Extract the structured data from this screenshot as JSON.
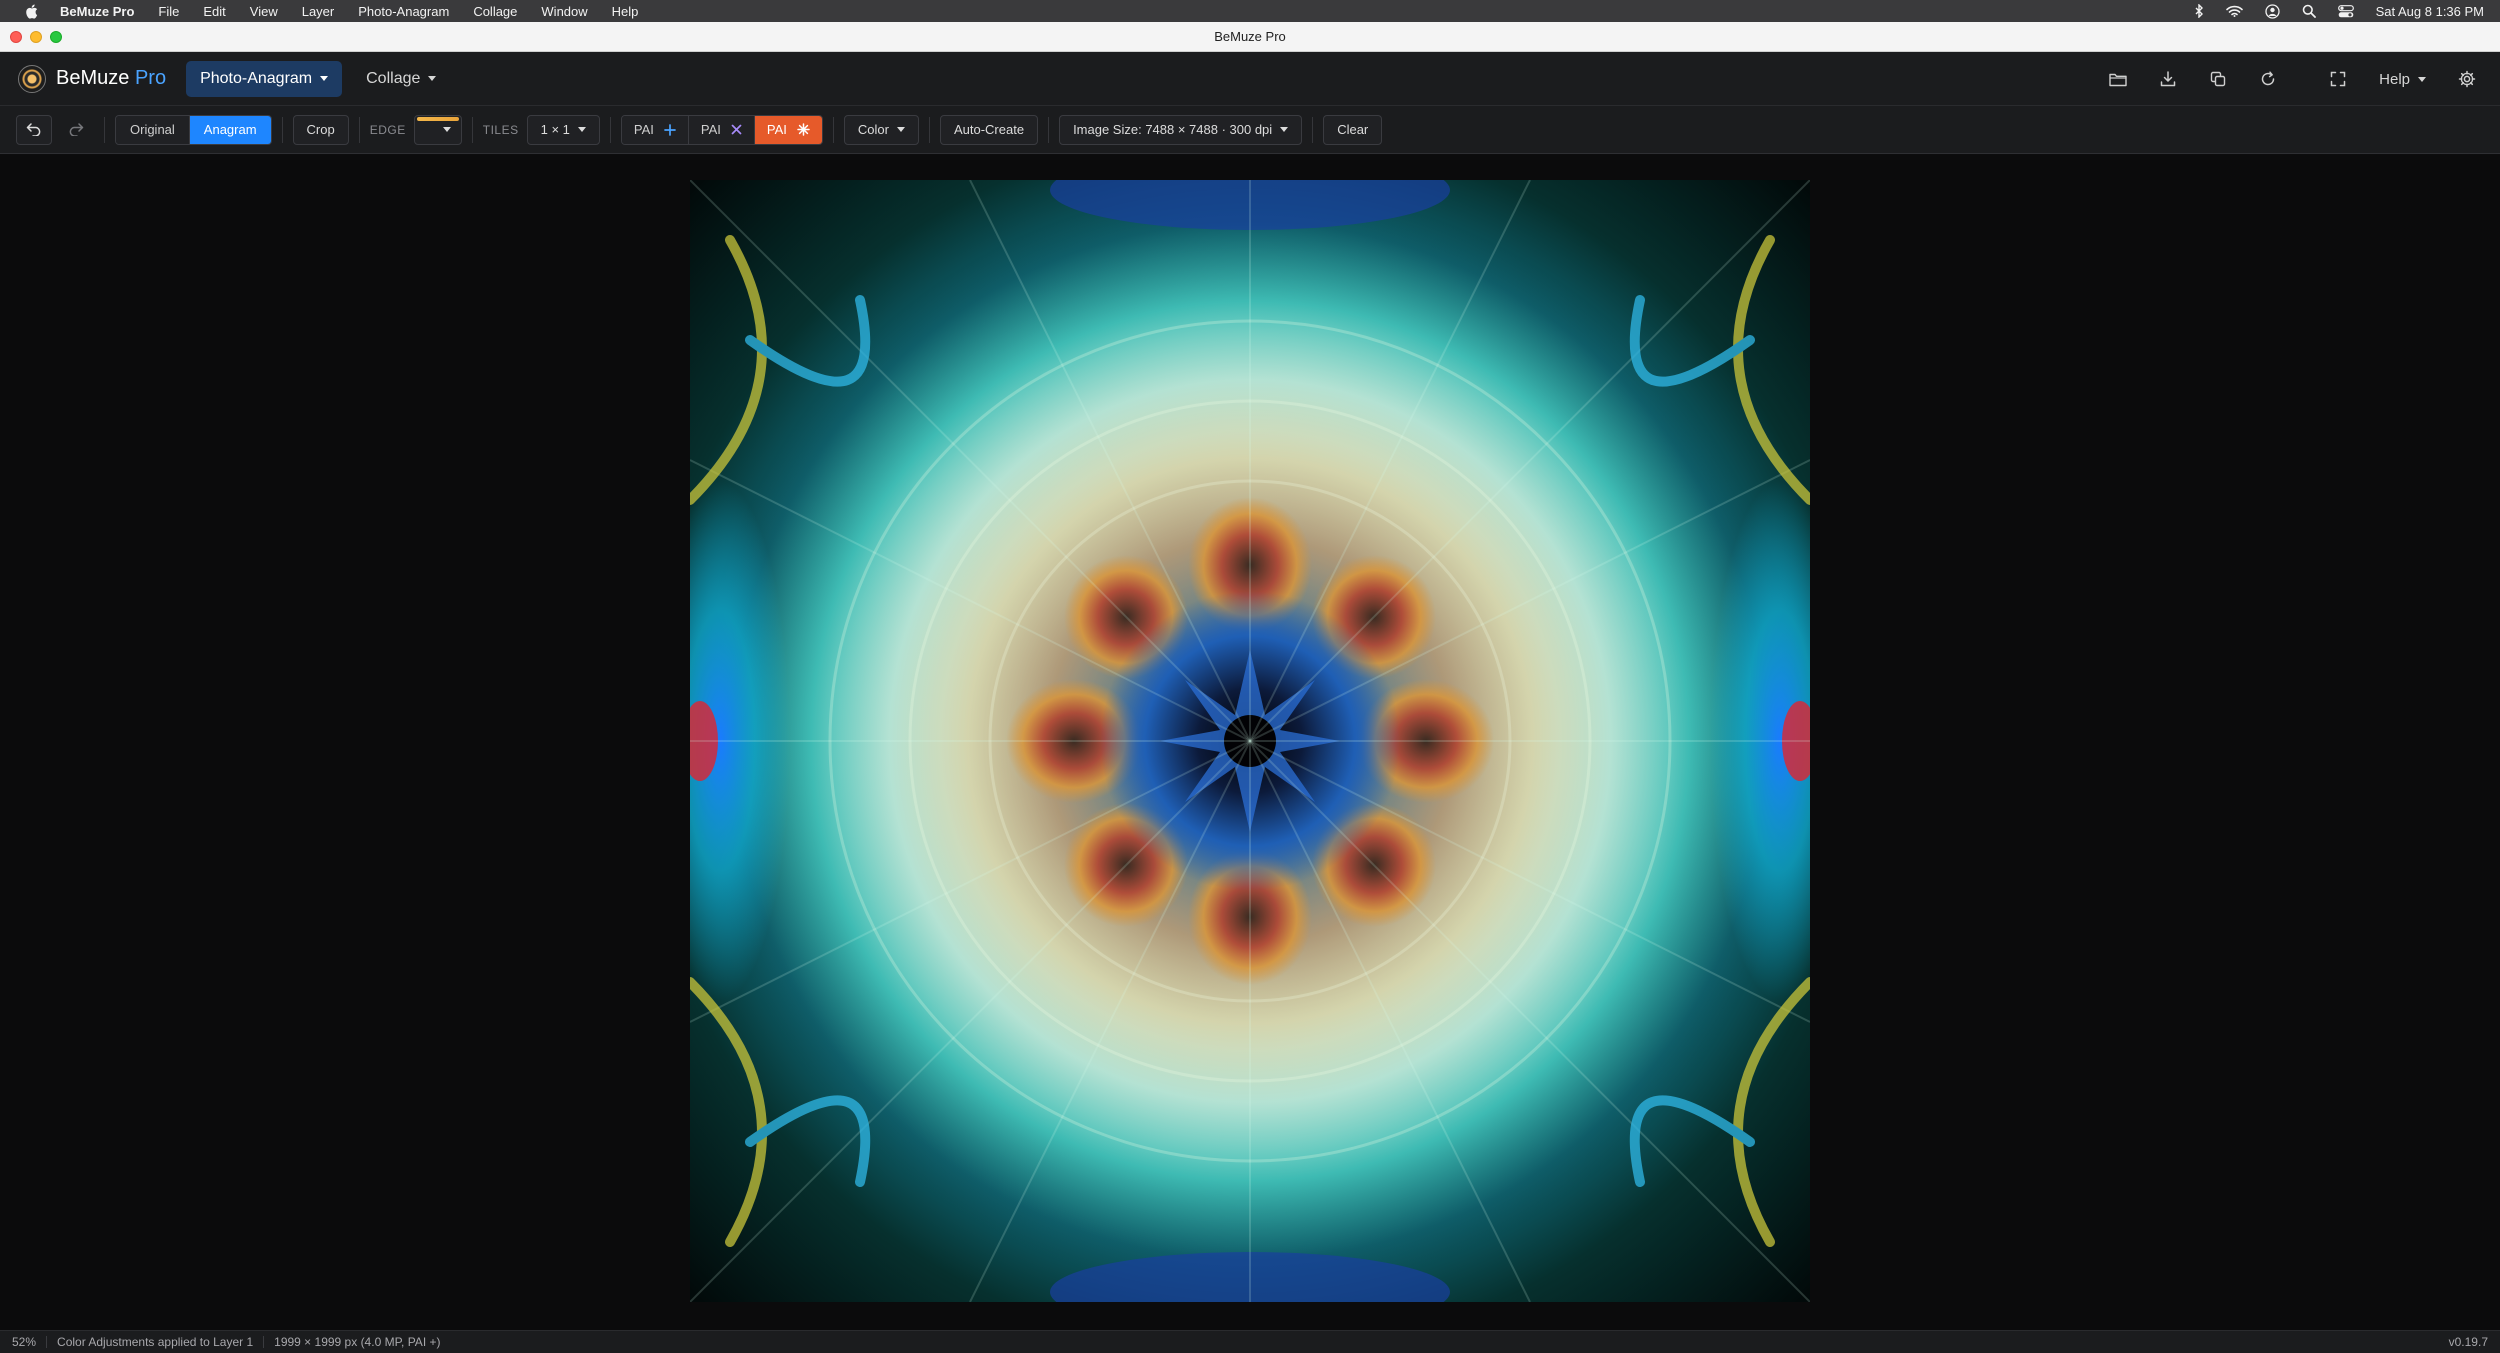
{
  "menubar": {
    "app_name": "BeMuze Pro",
    "items": [
      "File",
      "Edit",
      "View",
      "Layer",
      "Photo-Anagram",
      "Collage",
      "Window",
      "Help"
    ],
    "clock": "Sat Aug 8  1:36 PM"
  },
  "window": {
    "title": "BeMuze Pro"
  },
  "header": {
    "brand_name": "BeMuze",
    "brand_suffix": "Pro",
    "brand_accent": "#4aa3ff",
    "mode_active": "Photo-Anagram",
    "mode_other": "Collage",
    "help_label": "Help",
    "icons": [
      "folder-open-icon",
      "download-icon",
      "duplicate-icon",
      "refresh-icon",
      "fullscreen-icon",
      "settings-icon"
    ]
  },
  "toolbar": {
    "view_original": "Original",
    "view_anagram": "Anagram",
    "crop": "Crop",
    "edge_label": "EDGE",
    "tiles_label": "TILES",
    "tiles_value": "1 × 1",
    "pai_add": "PAI",
    "pai_remove": "PAI",
    "pai_active": "PAI",
    "color": "Color",
    "auto_create": "Auto-Create",
    "image_size": "Image Size: 7488 × 7488 · 300 dpi",
    "clear": "Clear",
    "accent_active": "#1e86ff",
    "accent_pai": "#e65a2a"
  },
  "status": {
    "zoom": "52%",
    "message": "Color Adjustments applied to Layer 1",
    "dimensions": "1999 × 1999 px (4.0 MP, PAI +)",
    "version": "v0.19.7"
  }
}
